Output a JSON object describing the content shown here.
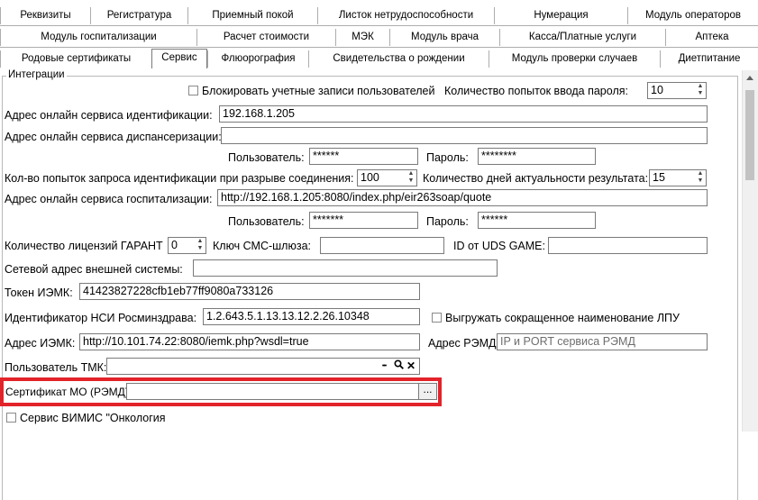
{
  "tabs": {
    "row1": [
      {
        "label": "Реквизиты"
      },
      {
        "label": "Регистратура"
      },
      {
        "label": "Приемный покой"
      },
      {
        "label": "Листок нетрудоспособности"
      },
      {
        "label": "Нумерация"
      },
      {
        "label": "Модуль операторов"
      }
    ],
    "row2": [
      {
        "label": "Модуль госпитализации"
      },
      {
        "label": "Расчет стоимости"
      },
      {
        "label": "МЭК"
      },
      {
        "label": "Модуль врача"
      },
      {
        "label": "Касса/Платные услуги"
      },
      {
        "label": "Аптека"
      }
    ],
    "row3": [
      {
        "label": "Родовые сертификаты"
      },
      {
        "label": "Сервис",
        "active": true
      },
      {
        "label": "Флюорография"
      },
      {
        "label": "Свидетельства о рождении"
      },
      {
        "label": "Модуль проверки случаев"
      },
      {
        "label": "Диетпитание"
      }
    ]
  },
  "group": {
    "title": "Интеграции"
  },
  "form": {
    "block_accounts_label": "Блокировать учетные записи пользователей",
    "password_attempts_label": "Количество попыток ввода пароля:",
    "password_attempts_value": "10",
    "ident_service_label": "Адрес онлайн сервиса идентификации:",
    "ident_service_value": "192.168.1.205",
    "dispensary_service_label": "Адрес онлайн сервиса диспансеризации:",
    "dispensary_service_value": "",
    "user1_label": "Пользователь:",
    "user1_value": "******",
    "password1_label": "Пароль:",
    "password1_value": "********",
    "retry_label": "Кол-во попыток запроса идентификации при разрыве соединения:",
    "retry_value": "100",
    "days_label": "Количество дней актуальности результата:",
    "days_value": "15",
    "hosp_service_label": "Адрес онлайн сервиса госпитализации:",
    "hosp_service_value": "http://192.168.1.205:8080/index.php/eir263soap/quote",
    "user2_label": "Пользователь:",
    "user2_value": "*******",
    "password2_label": "Пароль:",
    "password2_value": "******",
    "garant_label": "Количество лицензий ГАРАНТ",
    "garant_value": "0",
    "sms_label": "Ключ СМС-шлюза:",
    "sms_value": "",
    "uds_label": "ID от UDS GAME:",
    "uds_value": "",
    "external_label": "Сетевой адрес внешней системы:",
    "external_value": "",
    "iemk_token_label": "Токен ИЭМК:",
    "iemk_token_value": "41423827228cfb1eb77ff9080a733126",
    "nsi_label": "Идентификатор НСИ Росминздрава:",
    "nsi_value": "1.2.643.5.1.13.13.12.2.26.10348",
    "short_name_label": "Выгружать сокращенное наименование ЛПУ",
    "iemk_addr_label": "Адрес ИЭМК:",
    "iemk_addr_value": "http://10.101.74.22:8080/iemk.php?wsdl=true",
    "remd_label": "Адрес РЭМД:",
    "remd_placeholder": "IP и PORT сервиса РЭМД",
    "tmk_label": "Пользователь ТМК:",
    "tmk_value": "",
    "cert_label": "Сертификат МО (РЭМД):",
    "cert_value": "",
    "cert_button": "...",
    "vimis_label": "Сервис ВИМИС \"Онкология"
  },
  "icons": {
    "dots": "•••",
    "search": "🔍",
    "close": "✕"
  },
  "colors": {
    "highlight": "#e3232a"
  }
}
